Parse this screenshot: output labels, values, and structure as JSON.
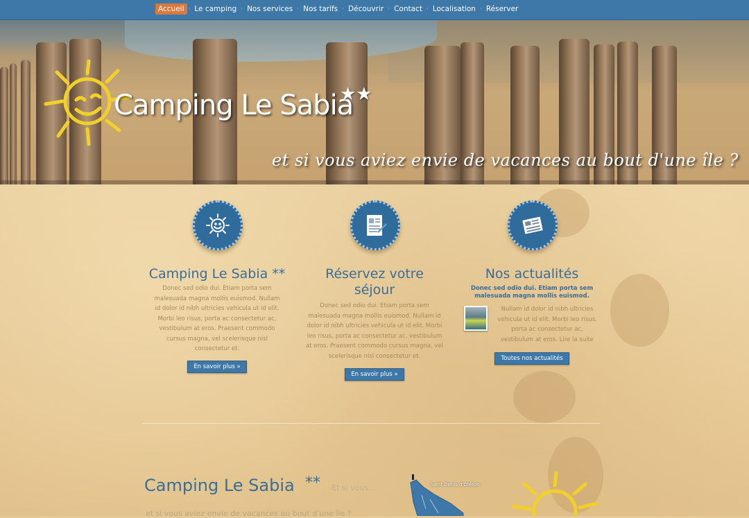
{
  "nav": {
    "items": [
      {
        "label": "Accueil",
        "active": true
      },
      {
        "label": "Le camping"
      },
      {
        "label": "Nos services"
      },
      {
        "label": "Nos tarifs"
      },
      {
        "label": "Découvrir"
      },
      {
        "label": "Contact"
      },
      {
        "label": "Localisation"
      },
      {
        "label": "Réserver"
      }
    ],
    "separator": "·"
  },
  "hero": {
    "brand": "Camping Le Sabia",
    "stars": "★★",
    "tagline": "et si vous aviez envie de vacances au bout d'une île ?"
  },
  "features": {
    "camping": {
      "icon": "sun-icon",
      "title": "Camping Le Sabia **",
      "text": "Donec sed odio dui. Etiam porta sem malesuada magna mollis euismod. Nullam id dolor id nibh ultricies vehicula ut id elit. Morbi leo risus, porta ac consectetur ac, vestibulum at eros. Praesent commodo cursus magna, vel scelerisque nisl consectetur et.",
      "button": "En savoir plus »"
    },
    "reservation": {
      "icon": "booking-form-icon",
      "title": "Réservez votre séjour",
      "text": "Donec sed odio dui. Etiam porta sem malesuada magna mollis euismod. Nullam id dolor id nibh ultricies vehicula ut id elit. Morbi leo risus, porta ac consectetur ac, vestibulum at eros. Praesent commodo cursus magna, vel scelerisque nisl consectetur et.",
      "button": "En savoir plus »"
    },
    "news": {
      "icon": "newspaper-icon",
      "title": "Nos actualités",
      "lead": "Donec sed odio dui. Etiam porta sem malesuada magna mollis euismod.",
      "text": "Nullam id dolor id nibh ultricies vehicula ut id elit. Morbi leo risus, porta ac consectetur ac, vestibulum at eros.",
      "more_link": "Lire la suite",
      "button": "Toutes nos actualités"
    }
  },
  "bottom": {
    "title": "Camping Le Sabia",
    "stars": "**",
    "subtitle": "Et si vous...",
    "line": "et si vous aviez envie de vacances au bout d'une île ?",
    "map_label": "Saint Denis d'Oléron"
  },
  "colors": {
    "nav": "#3d78a8",
    "accent": "#d87a3e",
    "heading": "#3a6e99",
    "badge": "#2f6b9b"
  }
}
